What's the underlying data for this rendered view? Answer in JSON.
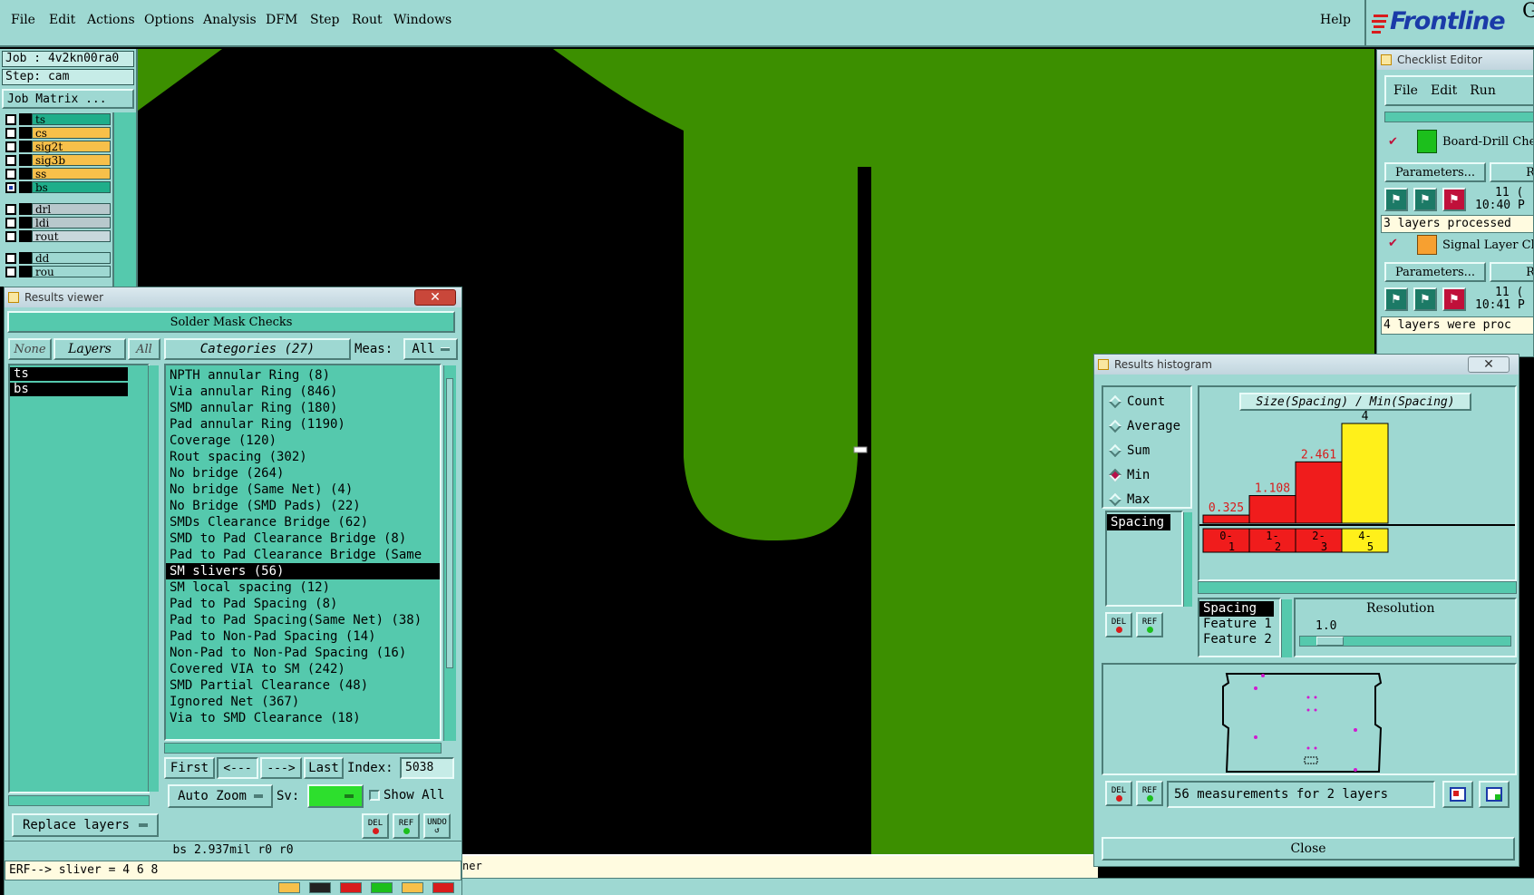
{
  "menubar": {
    "items": [
      "File",
      "Edit",
      "Actions",
      "Options",
      "Analysis",
      "DFM",
      "Step",
      "Rout",
      "Windows"
    ],
    "help": "Help",
    "brand": "Frontline",
    "brand_tail": "G"
  },
  "job": {
    "job_label": "Job : 4v2kn00ra0",
    "step_label": "Step: cam",
    "matrix_button": "Job Matrix ..."
  },
  "layers": [
    {
      "name": "ts",
      "color": "#1fae8a",
      "checked": false
    },
    {
      "name": "cs",
      "color": "#f7c04a",
      "checked": false
    },
    {
      "name": "sig2t",
      "color": "#f7c04a",
      "checked": false
    },
    {
      "name": "sig3b",
      "color": "#f7c04a",
      "checked": false
    },
    {
      "name": "ss",
      "color": "#f7c04a",
      "checked": false
    },
    {
      "name": "bs",
      "color": "#1fae8a",
      "checked": true
    },
    {
      "name": "drl",
      "color": "#b8c8cc",
      "checked": false
    },
    {
      "name": "ldi",
      "color": "#b8c8cc",
      "checked": false
    },
    {
      "name": "rout",
      "color": "#c8d8dc",
      "checked": false
    },
    {
      "name": "dd",
      "color": "#9ed8d2",
      "checked": false
    },
    {
      "name": "rou",
      "color": "#9ed8d2",
      "checked": false
    }
  ],
  "results_viewer": {
    "title": "Results viewer",
    "header": "Solder Mask Checks",
    "none_btn": "None",
    "layers_btn": "Layers",
    "all_btn": "All",
    "categories_btn": "Categories (27)",
    "meas_label": "Meas:",
    "meas_value": "All",
    "layer_list": [
      "ts",
      "bs"
    ],
    "categories": [
      "NPTH annular Ring (8)",
      "Via annular Ring (846)",
      "SMD annular Ring (180)",
      "Pad annular Ring (1190)",
      "Coverage (120)",
      "Rout spacing (302)",
      "No bridge (264)",
      "No bridge (Same Net) (4)",
      "No Bridge (SMD Pads) (22)",
      "SMDs Clearance Bridge (62)",
      "SMD to Pad Clearance Bridge (8)",
      "Pad to Pad Clearance Bridge (Same",
      "SM slivers (56)",
      "SM local spacing (12)",
      "Pad to Pad Spacing (8)",
      "Pad to Pad Spacing(Same Net) (38)",
      "Pad to Non-Pad Spacing (14)",
      "Non-Pad to Non-Pad Spacing (16)",
      "Covered VIA to SM (242)",
      "SMD Partial Clearance (48)",
      "Ignored Net (367)",
      "Via to SMD Clearance (18)"
    ],
    "selected_category": "SM slivers (56)",
    "first_btn": "First",
    "prev_btn": "<---",
    "next_btn": "--->",
    "last_btn": "Last",
    "index_label": "Index:",
    "index_value": "5038",
    "zoom_value": "Auto Zoom",
    "sv_label": "Sv:",
    "show_all": "Show All",
    "replace_layers": "Replace layers",
    "del": "DEL",
    "ref": "REF",
    "undo": "UNDO",
    "status": "bs 2.937mil  r0  r0",
    "erf": "ERF--> sliver = 4 6 8",
    "bottom_fragment": "ner"
  },
  "histogram": {
    "title": "Results histogram",
    "modes": [
      "Count",
      "Average",
      "Sum",
      "Min",
      "Max"
    ],
    "selected_mode": "Min",
    "chart_title": "Size(Spacing) / Min(Spacing)",
    "measure_list": [
      "Spacing"
    ],
    "chart_data": {
      "type": "bar",
      "categories": [
        "0-1",
        "1-2",
        "2-3",
        "4-5"
      ],
      "values": [
        0.325,
        1.108,
        2.461,
        4
      ],
      "labels": [
        "0.325",
        "1.108",
        "2.461",
        "4"
      ],
      "colors": [
        "#f01c1c",
        "#f01c1c",
        "#f01c1c",
        "#fff01a"
      ],
      "title": "Size(Spacing) / Min(Spacing)"
    },
    "bottom_list": [
      "Spacing",
      "Feature 1",
      "Feature 2"
    ],
    "resolution_label": "Resolution",
    "resolution_value": "1.0",
    "del": "DEL",
    "ref": "REF",
    "status": "56 measurements for 2 layers",
    "close": "Close"
  },
  "checklist": {
    "title": "Checklist Editor",
    "menu": [
      "File",
      "Edit",
      "Run"
    ],
    "items": [
      {
        "name": "Board-Drill Che",
        "params": "Parameters...",
        "ra": "Ra",
        "date": "11 (",
        "time": "10:40 P",
        "status": "3 layers processed"
      },
      {
        "name": "Signal Layer Ch",
        "params": "Parameters...",
        "ra": "Ra",
        "date": "11 (",
        "time": "10:41 P",
        "status": "4 layers were proc"
      }
    ]
  },
  "colors": {
    "panel": "#9ed8d2",
    "list_bg": "#55c9ad",
    "copper": "#3c8f00",
    "black": "#000000"
  }
}
